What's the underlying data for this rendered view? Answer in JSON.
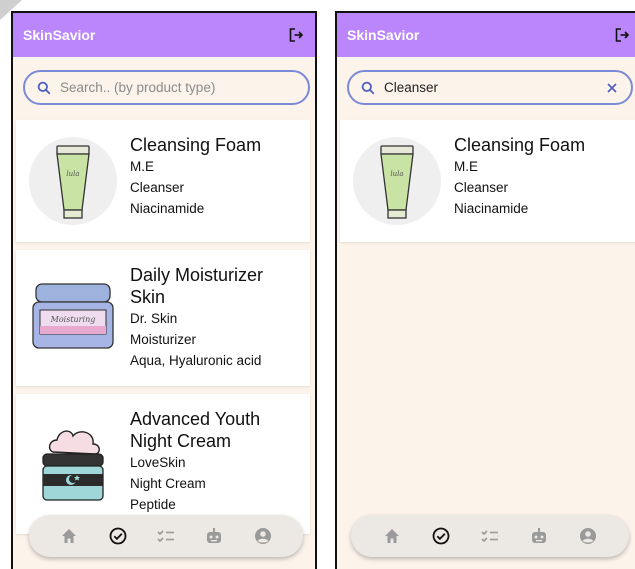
{
  "app": {
    "title": "SkinSavior"
  },
  "colors": {
    "accent": "#bb86fc",
    "background": "#fcf3ea",
    "search_border": "#7b8ad6",
    "nav_icon_inactive": "#9a9a9a",
    "nav_icon_active": "#111111"
  },
  "left_screen": {
    "search": {
      "placeholder": "Search.. (by product type)",
      "value": ""
    },
    "products": [
      {
        "name": "Cleansing Foam",
        "brand": "M.E",
        "type": "Cleanser",
        "ingredients": "Niacinamide",
        "image": "tube-icon"
      },
      {
        "name": "Daily Moisturizer Skin",
        "brand": "Dr. Skin",
        "type": "Moisturizer",
        "ingredients": "Aqua, Hyaluronic acid",
        "image": "jar-icon",
        "jar_label": "Moisturing"
      },
      {
        "name": "Advanced Youth Night Cream",
        "brand": "LoveSkin",
        "type": "Night Cream",
        "ingredients": "Peptide",
        "image": "night-cream-icon"
      }
    ]
  },
  "right_screen": {
    "search": {
      "placeholder": "Search.. (by product type)",
      "value": "Cleanser"
    },
    "products": [
      {
        "name": "Cleansing Foam",
        "brand": "M.E",
        "type": "Cleanser",
        "ingredients": "Niacinamide",
        "image": "tube-icon"
      }
    ]
  },
  "nav": {
    "items": [
      {
        "icon": "home-icon",
        "active": false
      },
      {
        "icon": "check-circle-icon",
        "active": true
      },
      {
        "icon": "checklist-icon",
        "active": false
      },
      {
        "icon": "robot-icon",
        "active": false
      },
      {
        "icon": "account-icon",
        "active": false
      }
    ]
  }
}
